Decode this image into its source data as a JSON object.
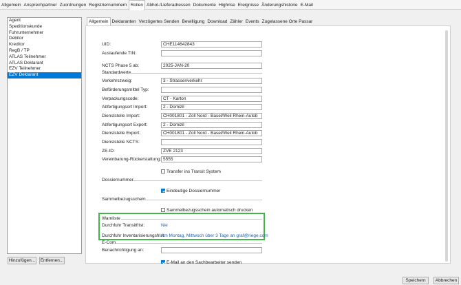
{
  "top_tabs": [
    "Allgemein",
    "Ansprechpartner",
    "Zuordnungen",
    "Registriernummern",
    "Rollen",
    "Abhol-/Lieferadressen",
    "Dokumente",
    "Highrise",
    "Ereignisse",
    "Änderungshistorie",
    "E-Mail"
  ],
  "roles": [
    "Agent",
    "Speditionskunde",
    "Fuhrunternehmer",
    "Debitor",
    "Kreditor",
    "RegB / TP",
    "ATLAS Teilnehmer",
    "ATLAS Deklarant",
    "EZV Teilnehmer",
    "EZV Deklarant"
  ],
  "buttons": {
    "add": "Hinzufügen...",
    "remove": "Entfernen...",
    "save": "Speichern",
    "cancel": "Abbrechen"
  },
  "sub_tabs": [
    "Allgemein",
    "Deklaranten",
    "Verzögertes Senden",
    "Bewilligung",
    "Download",
    "Zähler",
    "Events",
    "Zugelassene Orte Passar"
  ],
  "fields": {
    "uid": {
      "label": "UID:",
      "value": "CHE114642843"
    },
    "auslaufende_tin": {
      "label": "Auslaufende TIN:",
      "value": ""
    },
    "ncts": {
      "label": "NCTS Phase 5 ab:",
      "value": "2025-JAN-20"
    },
    "verkehrszweig": {
      "label": "Verkehrszweig:",
      "value": "3 - Strassenverkehr"
    },
    "befoerderungsmittel": {
      "label": "Beförderungsmittel Typ:",
      "value": ""
    },
    "verpackungscode": {
      "label": "Verpackungscode:",
      "value": "CT - Karton"
    },
    "abfertigungsort_import": {
      "label": "Abfertigungsort Import:",
      "value": "2 - Domizil"
    },
    "dienststelle_import": {
      "label": "Dienststelle Import:",
      "value": "CH001801 - Zoll Nord - Basel/Weil Rhein-Autob"
    },
    "abfertigungsort_export": {
      "label": "Abfertigungsort Export:",
      "value": "2 - Domizil"
    },
    "dienststelle_export": {
      "label": "Dienststelle Export:",
      "value": "CH001801 - Zoll Nord - Basel/Weil Rhein-Autob"
    },
    "dienststelle_ncts": {
      "label": "Dienststelle NCTS:",
      "value": ""
    },
    "ze_id": {
      "label": "ZE-ID:",
      "value": "ZVE 2123"
    },
    "vereinbarung": {
      "label": "Vereinbarung-Rückerstattung:",
      "value": "5555"
    }
  },
  "sections": {
    "standardwerte": "Standardwerte",
    "dossiernummer": "Dossiernummer",
    "sammelbezugsschein": "Sammelbezugsschein",
    "warnliste": "Warnliste",
    "email": "E-Com"
  },
  "checkboxes": {
    "transfer": {
      "label": "Transfer ins Transit System",
      "checked": false
    },
    "eindeutige": {
      "label": "Eindeutige Dossiernummer",
      "checked": true
    },
    "sammel_drucken": {
      "label": "Sammelbezugsschein automatisch drucken",
      "checked": false
    },
    "email_sachbearbeiter": {
      "label": "E-Mail an den Sachbearbeiter senden",
      "checked": true
    }
  },
  "warnliste": {
    "transitfrist": {
      "label": "Durchfuhr Transitfrist:",
      "value": "Nie"
    },
    "inventarisierungsfrist": {
      "label": "Durchfuhr Inventarisierungsfrist:",
      "value": "Am Montag, Mittwoch über 3 Tage an graf@riege.com"
    }
  },
  "benachrichtigung": {
    "label": "Benachrichtigung an:",
    "value": ""
  }
}
